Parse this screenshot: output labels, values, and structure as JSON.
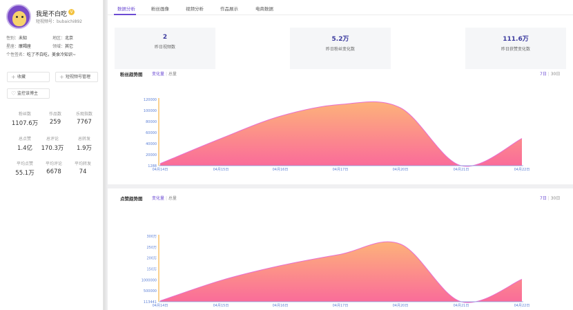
{
  "profile": {
    "name": "我是不白吃",
    "verified_badge": "V",
    "account": "短视频号：bubaichi892",
    "gender_label": "性别：",
    "gender": "未知",
    "region_label": "地区：",
    "region": "北京",
    "constellation_label": "星座：",
    "constellation": "摩羯座",
    "field_label": "领域：",
    "field": "其它",
    "signature_label": "个性签名：",
    "signature": "吃了不白吃，美食冷知识~"
  },
  "sidebar_buttons": {
    "favorite": "收藏",
    "manage": "短视频号管理",
    "monitor": "监控该博主"
  },
  "stats": [
    {
      "label": "粉丝数",
      "value": "1107.6万"
    },
    {
      "label": "作品数",
      "value": "259"
    },
    {
      "label": "乐观指数",
      "value": "7767"
    },
    {
      "label": "总点赞",
      "value": "1.4亿"
    },
    {
      "label": "总评论",
      "value": "170.3万"
    },
    {
      "label": "总转发",
      "value": "1.9万"
    },
    {
      "label": "平均点赞",
      "value": "55.1万"
    },
    {
      "label": "平均评论",
      "value": "6678"
    },
    {
      "label": "平均转发",
      "value": "74"
    }
  ],
  "tabs": [
    "数据分析",
    "粉丝画像",
    "视频分析",
    "作品展示",
    "电商数据"
  ],
  "kpis": [
    {
      "value": "2",
      "label": "昨日视频数"
    },
    {
      "value": "5.2万",
      "label": "昨日粉丝变化数"
    },
    {
      "value": "111.6万",
      "label": "昨日获赞变化数"
    }
  ],
  "fans_chart": {
    "title": "粉丝趋势图",
    "seg_active": "变化量",
    "seg_other": "总量",
    "range_7": "7日",
    "range_30": "30日"
  },
  "likes_chart": {
    "title": "点赞趋势图",
    "seg_active": "变化量",
    "seg_other": "总量",
    "range_7": "7日",
    "range_30": "30日"
  },
  "colors": {
    "accent": "#6c4bd3",
    "area_top": "#fdb27a",
    "area_bottom": "#fa6b9a",
    "axis": "#f5a623"
  },
  "chart_data": [
    {
      "type": "area",
      "categories": [
        "04月14日",
        "04月15日",
        "04月16日",
        "04月17日",
        "04月20日",
        "04月21日",
        "04月22日"
      ],
      "values": [
        5000,
        50000,
        90000,
        111000,
        105000,
        1288,
        50000
      ],
      "yticks": [
        "120000",
        "100000",
        "80000",
        "60000",
        "40000",
        "20000",
        "1288"
      ],
      "ylim": [
        1288,
        120000
      ]
    },
    {
      "type": "area",
      "categories": [
        "04月14日",
        "04月15日",
        "04月16日",
        "04月17日",
        "04月20日",
        "04月21日",
        "04月22日"
      ],
      "values": [
        150000,
        1050000,
        1700000,
        2200000,
        2650000,
        113441,
        1100000
      ],
      "yticks": [
        "300万",
        "250万",
        "200万",
        "150万",
        "1000000",
        "500000",
        "113441"
      ],
      "ylim": [
        113441,
        3000000
      ]
    }
  ]
}
